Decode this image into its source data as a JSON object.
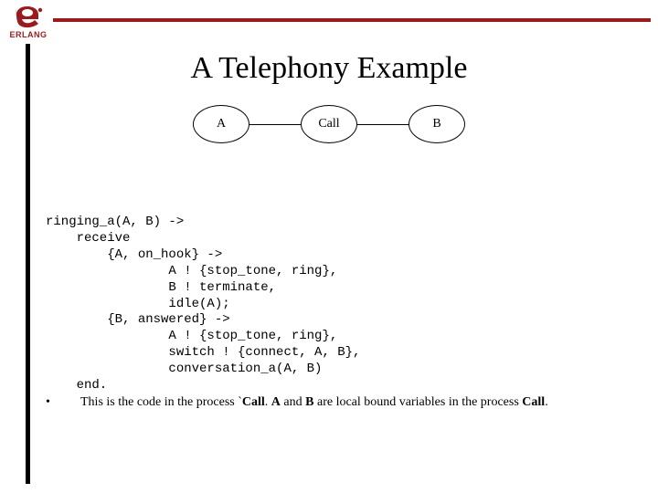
{
  "brand": {
    "name": "ERLANG",
    "color": "#9a1b1e"
  },
  "title": "A Telephony Example",
  "diagram": {
    "nodes": [
      "A",
      "Call",
      "B"
    ]
  },
  "code": {
    "l1": "ringing_a(A, B) ->",
    "l2": "    receive",
    "l3": "        {A, on_hook} ->",
    "l4": "                A ! {stop_tone, ring},",
    "l5": "                B ! terminate,",
    "l6": "                idle(A);",
    "l7": "        {B, answered} ->",
    "l8": "                A ! {stop_tone, ring},",
    "l9": "                switch ! {connect, A, B},",
    "l10": "                conversation_a(A, B)",
    "l11": "    end."
  },
  "note": {
    "bullet": "•",
    "pre": "This is the code in the process `",
    "call": "Call",
    "mid1": ". ",
    "a": "A",
    "mid2": " and ",
    "b": "B",
    "mid3": " are local bound variables in the process ",
    "call2": "Call",
    "post": "."
  }
}
